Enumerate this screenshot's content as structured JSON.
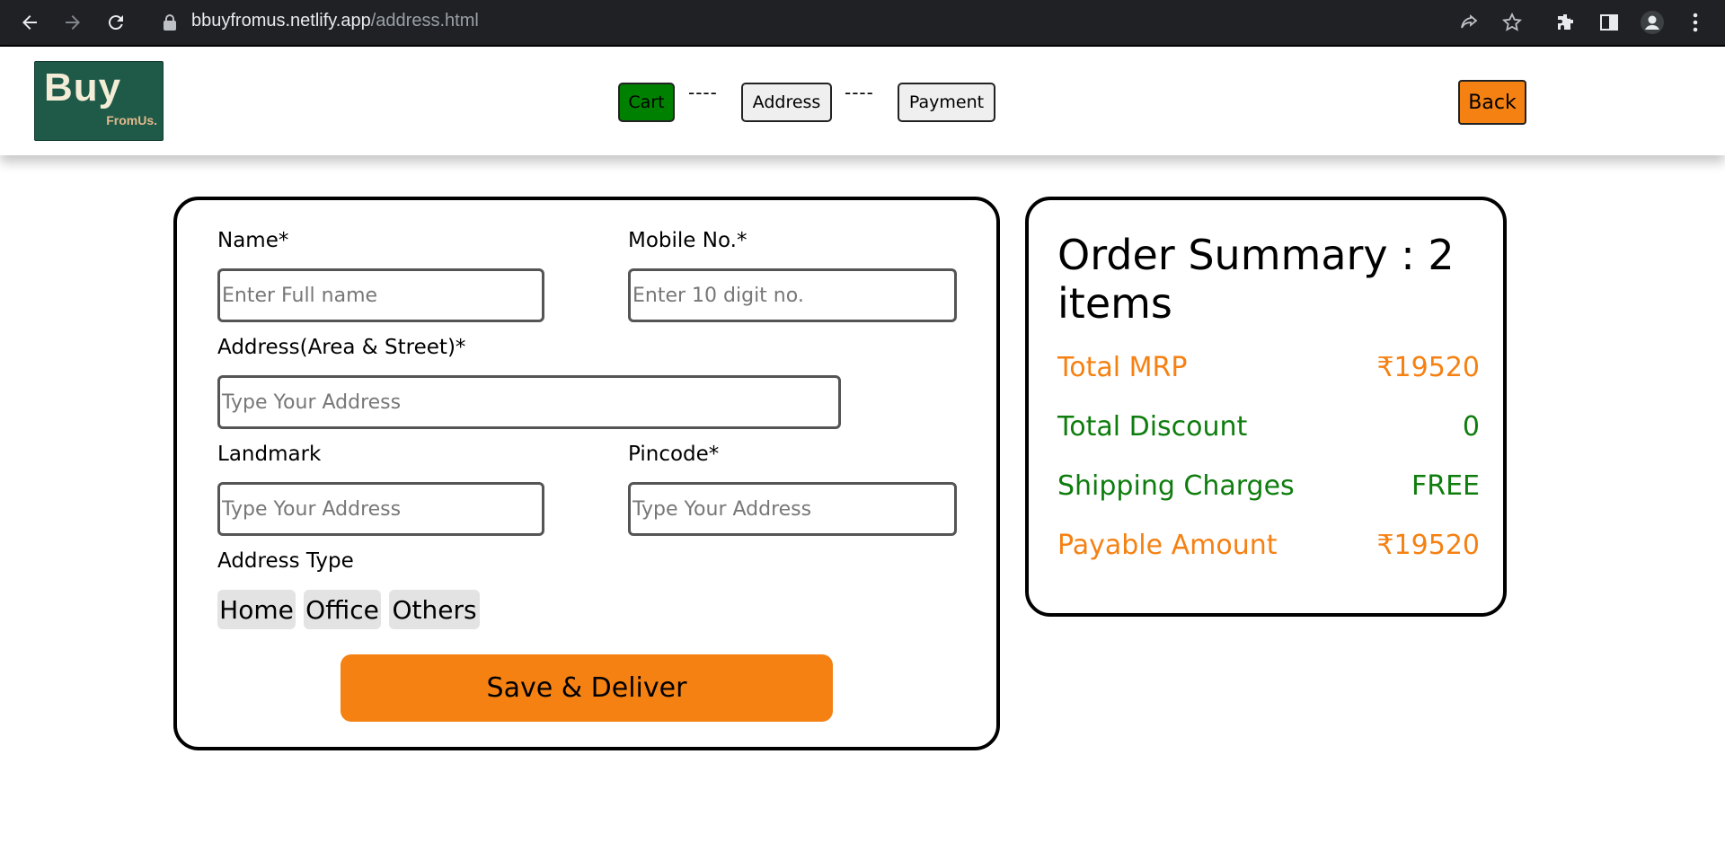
{
  "browser": {
    "url_host": "bbuyfromus.netlify.app",
    "url_path": "/address.html",
    "icons": [
      "back-arrow-icon",
      "forward-arrow-icon",
      "reload-icon",
      "lock-icon",
      "share-icon",
      "star-icon",
      "extensions-icon",
      "side-panel-icon",
      "profile-icon",
      "kebab-menu-icon"
    ]
  },
  "header": {
    "logo_main": "Buy",
    "logo_sub": "FromUs.",
    "steps": {
      "cart": "Cart",
      "address": "Address",
      "payment": "Payment",
      "separator": "----"
    },
    "back_label": "Back",
    "colors": {
      "cart_step": "#008000",
      "back_button": "#f58113"
    }
  },
  "form": {
    "name_label": "Name*",
    "name_placeholder": "Enter Full name",
    "mobile_label": "Mobile No.*",
    "mobile_placeholder": "Enter 10 digit no.",
    "address_label": "Address(Area & Street)*",
    "address_placeholder": "Type Your Address",
    "landmark_label": "Landmark",
    "landmark_placeholder": "Type Your Address",
    "pincode_label": "Pincode*",
    "pincode_placeholder": "Type Your Address",
    "address_type_label": "Address Type",
    "address_types": [
      "Home",
      "Office",
      "Others"
    ],
    "save_label": "Save & Deliver"
  },
  "summary": {
    "title": "Order Summary : 2 items",
    "rows": [
      {
        "label": "Total MRP",
        "value": "₹19520",
        "color": "#f58113"
      },
      {
        "label": "Total Discount",
        "value": "0",
        "color": "#0e7d0e"
      },
      {
        "label": "Shipping Charges",
        "value": "FREE",
        "color": "#0e7d0e"
      },
      {
        "label": "Payable Amount",
        "value": "₹19520",
        "color": "#f58113"
      }
    ]
  }
}
